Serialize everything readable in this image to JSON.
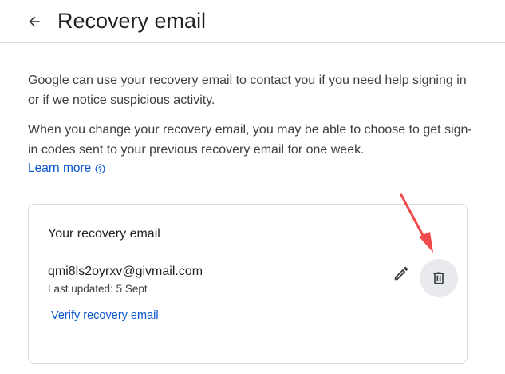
{
  "header": {
    "back_icon": "arrow-back-icon",
    "title": "Recovery email"
  },
  "description": {
    "paragraph1": "Google can use your recovery email to contact you if you need help signing in or if we notice suspicious activity.",
    "paragraph2": "When you change your recovery email, you may be able to choose to get sign-in codes sent to your previous recovery email for one week.",
    "learn_more": "Learn more",
    "help_icon": "help-circle-icon"
  },
  "card": {
    "title": "Your recovery email",
    "email": "qmi8ls2oyrxv@givmail.com",
    "last_updated": "Last updated: 5 Sept",
    "verify_link": "Verify recovery email",
    "edit_icon": "pencil-icon",
    "delete_icon": "trash-icon"
  },
  "colors": {
    "link": "#0b57d0",
    "divider": "#dadce0",
    "delete_bg": "#e8eaed",
    "annotation": "#f04a4a"
  }
}
